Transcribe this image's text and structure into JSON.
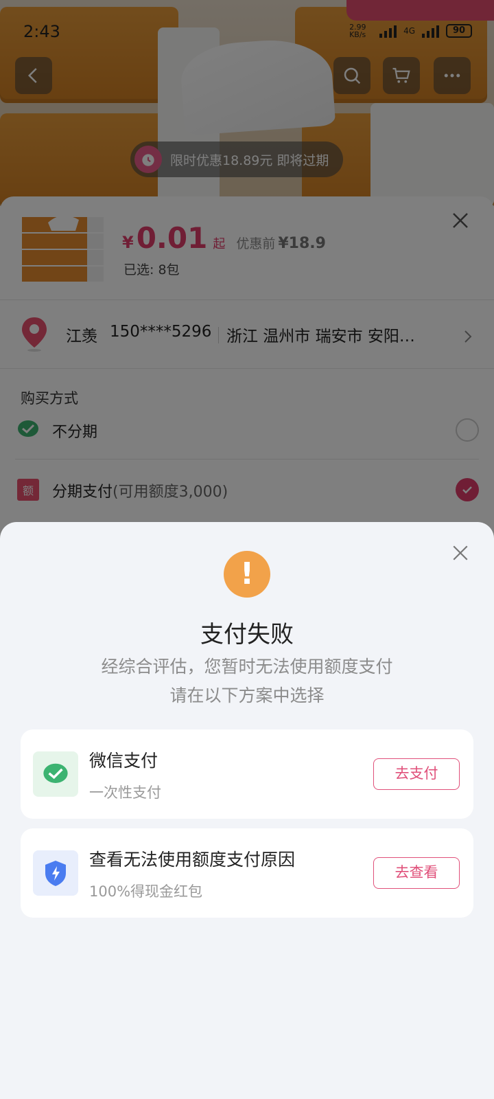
{
  "status_bar": {
    "time": "2:43",
    "net_speed": "2.99 KB/s",
    "net_type": "4G",
    "battery": "90"
  },
  "hero": {
    "timer_text": "限时优惠18.89元 即将过期"
  },
  "product": {
    "currency": "¥",
    "price": "0.01",
    "price_suffix": "起",
    "before_label": "优惠前",
    "before_price": "¥18.9",
    "selected": "已选: 8包"
  },
  "address": {
    "name": "江羡",
    "phone": "150****5296",
    "location": "浙江 温州市 瑞安市 安阳…"
  },
  "purchase": {
    "title": "购买方式",
    "options": [
      {
        "label": "不分期",
        "sub": "",
        "checked": false
      },
      {
        "label": "分期支付",
        "sub": "(可用额度3,000)",
        "checked": true
      }
    ]
  },
  "modal": {
    "title": "支付失败",
    "desc_line1": "经综合评估，您暂时无法使用额度支付",
    "desc_line2": "请在以下方案中选择",
    "cards": [
      {
        "title": "微信支付",
        "sub": "一次性支付",
        "button": "去支付"
      },
      {
        "title": "查看无法使用额度支付原因",
        "sub": "100%得现金红包",
        "button": "去查看"
      }
    ]
  },
  "colors": {
    "accent": "#e03c6a",
    "warning": "#f2a24a",
    "wechat": "#3cb371",
    "shield": "#4a7cf0"
  }
}
